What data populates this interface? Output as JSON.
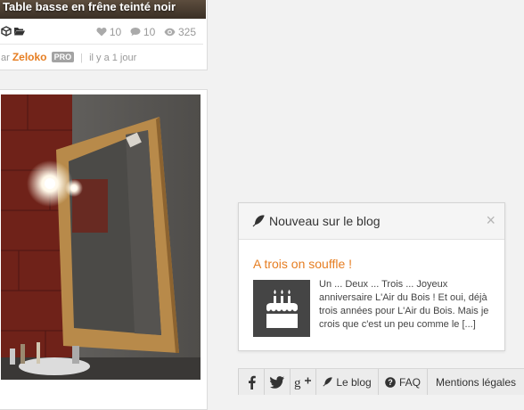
{
  "top_card": {
    "title": "Table basse en frêne teinté noir",
    "stats": {
      "likes": "10",
      "comments": "10",
      "views": "325"
    },
    "byline": {
      "prefix": "ar",
      "author": "Zeloko",
      "badge": "PRO",
      "time": "il y a 1 jour"
    }
  },
  "blog_popup": {
    "header": "Nouveau sur le blog",
    "close": "×",
    "post_title": "A trois on souffle !",
    "excerpt": "Un ... Deux ... Trois ... Joyeux anniversaire L'Air du Bois ! Et oui, déjà trois années pour L'Air du Bois. Mais je crois que c'est un peu comme le",
    "more": "[...]"
  },
  "footer": {
    "blog": "Le blog",
    "faq": "FAQ",
    "legal": "Mentions légales"
  },
  "colors": {
    "accent": "#e67e22",
    "badge": "#a3a3a3"
  },
  "icons": [
    "cube-icon",
    "folder-open-icon",
    "heart-icon",
    "comment-icon",
    "eye-icon",
    "feather-icon",
    "birthday-cake-icon",
    "facebook-icon",
    "twitter-icon",
    "google-plus-icon",
    "question-circle-icon"
  ]
}
